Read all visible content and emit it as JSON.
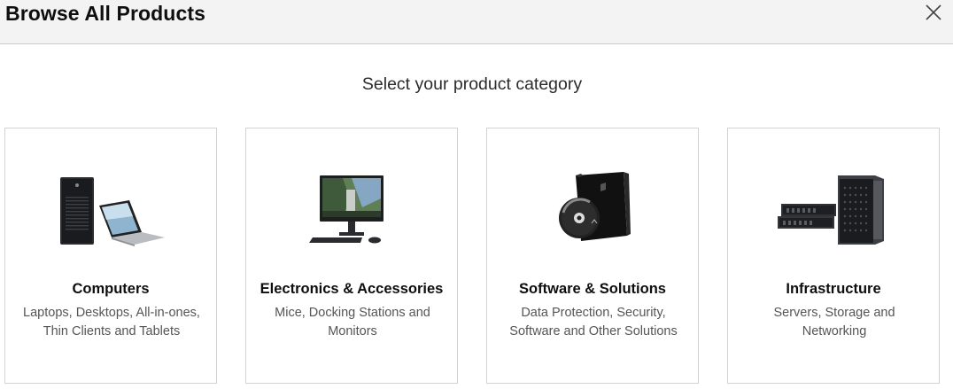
{
  "header": {
    "title": "Browse All Products",
    "close_icon": "close-icon"
  },
  "subtitle": "Select your product category",
  "categories": [
    {
      "title": "Computers",
      "description": "Laptops, Desktops, All-in-ones, Thin Clients and Tablets",
      "image": "desktop-tower-and-laptop"
    },
    {
      "title": "Electronics & Accessories",
      "description": "Mice, Docking Stations and Monitors",
      "image": "all-in-one-monitor-with-keyboard-mouse"
    },
    {
      "title": "Software & Solutions",
      "description": "Data Protection, Security, Software and Other Solutions",
      "image": "software-box-with-disc"
    },
    {
      "title": "Infrastructure",
      "description": "Servers, Storage and Networking",
      "image": "rack-servers-and-tower-server"
    }
  ]
}
